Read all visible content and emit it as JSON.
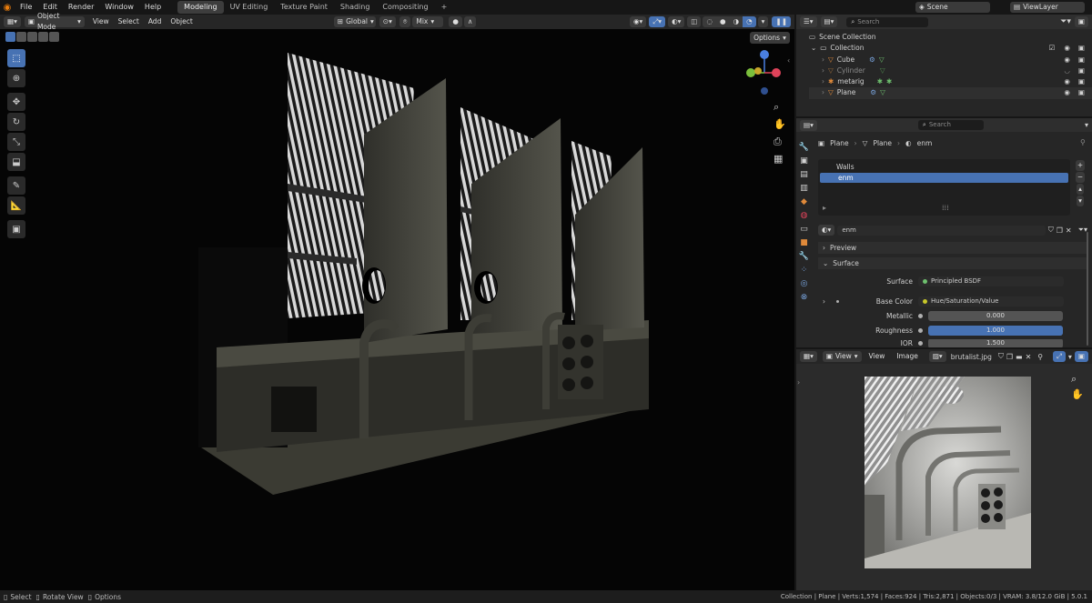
{
  "menubar": {
    "items": [
      "File",
      "Edit",
      "Render",
      "Window",
      "Help"
    ],
    "workspaces": [
      "Modeling",
      "UV Editing",
      "Texture Paint",
      "Shading",
      "Compositing"
    ],
    "active_workspace": "Modeling",
    "scene": "Scene",
    "view_layer": "ViewLayer"
  },
  "viewport": {
    "mode": "Object Mode",
    "menus": [
      "View",
      "Select",
      "Add",
      "Object"
    ],
    "orientation": "Global",
    "snap_label": "Mix",
    "options_label": "Options"
  },
  "outliner": {
    "search_placeholder": "Search",
    "scene_collection": "Scene Collection",
    "collection": "Collection",
    "items": [
      {
        "name": "Cube",
        "hidden": false
      },
      {
        "name": "Cylinder",
        "hidden": true
      },
      {
        "name": "metarig",
        "hidden": false
      },
      {
        "name": "Plane",
        "hidden": false
      }
    ]
  },
  "properties": {
    "search_placeholder": "Search",
    "breadcrumb": [
      "Plane",
      "Plane",
      "enm"
    ],
    "material_slots": [
      "Walls",
      "enm"
    ],
    "selected_slot": "enm",
    "material_name": "enm",
    "preview_label": "Preview",
    "surface_label": "Surface",
    "surface_row_label": "Surface",
    "surface_value": "Principled BSDF",
    "base_color_label": "Base Color",
    "base_color_value": "Hue/Saturation/Value",
    "metallic_label": "Metallic",
    "metallic_value": "0.000",
    "roughness_label": "Roughness",
    "roughness_value": "1.000",
    "roughness_fraction": 1.0,
    "ior_label": "IOR",
    "ior_value": "1.500"
  },
  "image_editor": {
    "menus": [
      "View",
      "View",
      "Image"
    ],
    "image_name": "brutalist.jpg"
  },
  "statusbar": {
    "select": "Select",
    "rotate": "Rotate View",
    "options": "Options",
    "stats": "Collection | Plane | Verts:1,574 | Faces:924 | Tris:2,871 | Objects:0/3 | VRAM: 3.8/12.0 GiB | 5.0.1"
  },
  "colors": {
    "accent": "#4772b3",
    "object_orange": "#e08a3a",
    "mesh_green": "#6ec06e",
    "axis_x": "#e0435a",
    "axis_y": "#7bbf3c",
    "axis_z": "#4a7fe0"
  }
}
